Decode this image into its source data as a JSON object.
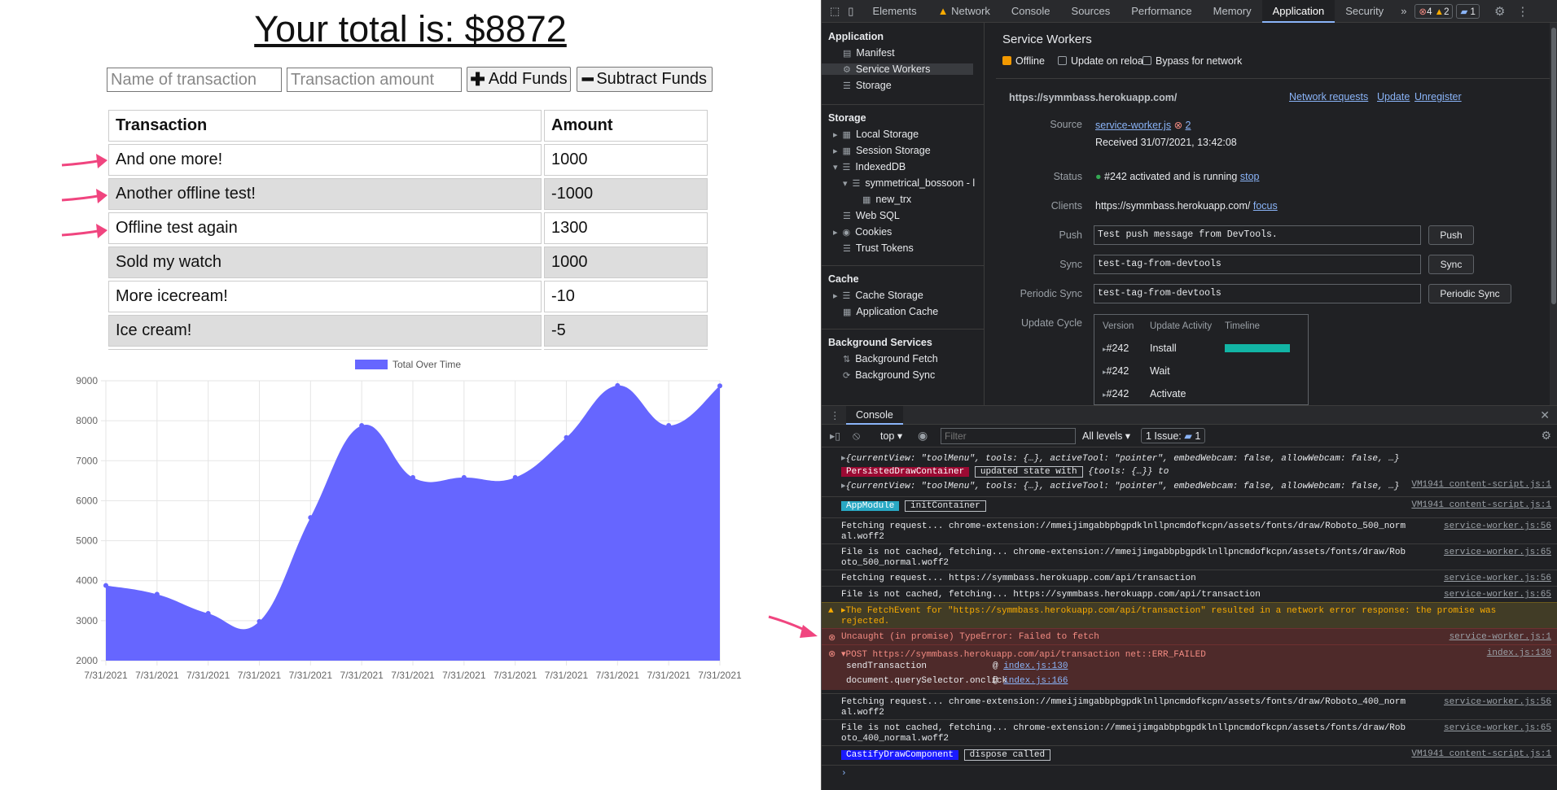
{
  "app": {
    "title": "Your total is: $8872",
    "name_placeholder": "Name of transaction",
    "amount_placeholder": "Transaction amount",
    "add_label": "Add Funds",
    "subtract_label": "Subtract Funds",
    "table_headers": [
      "Transaction",
      "Amount"
    ],
    "rows": [
      {
        "name": "And one more!",
        "amount": "1000"
      },
      {
        "name": "Another offline test!",
        "amount": "-1000"
      },
      {
        "name": "Offline test again",
        "amount": "1300"
      },
      {
        "name": "Sold my watch",
        "amount": "1000"
      },
      {
        "name": "More icecream!",
        "amount": "-10"
      },
      {
        "name": "Ice cream!",
        "amount": "-5"
      }
    ]
  },
  "chart_data": {
    "type": "area",
    "legend": "Total Over Time",
    "series_color": "#6666ff",
    "x": [
      "7/31/2021",
      "7/31/2021",
      "7/31/2021",
      "7/31/2021",
      "7/31/2021",
      "7/31/2021",
      "7/31/2021",
      "7/31/2021",
      "7/31/2021",
      "7/31/2021",
      "7/31/2021",
      "7/31/2021",
      "7/31/2021"
    ],
    "values": [
      3880,
      3660,
      3180,
      2980,
      5580,
      7880,
      6580,
      6580,
      6580,
      7580,
      8880,
      7880,
      8872
    ],
    "ylim": [
      2000,
      9000
    ],
    "yticks": [
      "9000",
      "8000",
      "7000",
      "6000",
      "5000",
      "4000",
      "3000",
      "2000"
    ],
    "grid": true
  },
  "devtools": {
    "tabs": [
      "Elements",
      "Network",
      "Console",
      "Sources",
      "Performance",
      "Memory",
      "Application",
      "Security"
    ],
    "active_tab": "Application",
    "errors": "4",
    "warnings": "2",
    "messages": "1",
    "sidebar": {
      "application_header": "Application",
      "application_items": [
        "Manifest",
        "Service Workers",
        "Storage"
      ],
      "storage_header": "Storage",
      "storage_items": [
        "Local Storage",
        "Session Storage",
        "IndexedDB",
        "symmetrical_bossoon - l",
        "new_trx",
        "Web SQL",
        "Cookies",
        "Trust Tokens"
      ],
      "cache_header": "Cache",
      "cache_items": [
        "Cache Storage",
        "Application Cache"
      ],
      "bg_header": "Background Services",
      "bg_items": [
        "Background Fetch",
        "Background Sync"
      ]
    },
    "sw": {
      "title": "Service Workers",
      "offline": "Offline",
      "update_on_reload": "Update on reload",
      "bypass": "Bypass for network",
      "origin": "https://symmbass.herokuapp.com/",
      "network_requests": "Network requests",
      "update": "Update",
      "unregister": "Unregister",
      "source_label": "Source",
      "source": "service-worker.js",
      "source_errors": "2",
      "received": "Received 31/07/2021, 13:42:08",
      "status_label": "Status",
      "status": "#242 activated and is running",
      "stop": "stop",
      "clients_label": "Clients",
      "clients": "https://symmbass.herokuapp.com/",
      "focus": "focus",
      "push_label": "Push",
      "push_value": "Test push message from DevTools.",
      "push_btn": "Push",
      "sync_label": "Sync",
      "sync_value": "test-tag-from-devtools",
      "sync_btn": "Sync",
      "psync_label": "Periodic Sync",
      "psync_value": "test-tag-from-devtools",
      "psync_btn": "Periodic Sync",
      "cycle_label": "Update Cycle",
      "cycle_headers": [
        "Version",
        "Update Activity",
        "Timeline"
      ],
      "cycle_rows": [
        {
          "v": "#242",
          "a": "Install"
        },
        {
          "v": "#242",
          "a": "Wait"
        },
        {
          "v": "#242",
          "a": "Activate"
        }
      ]
    },
    "console": {
      "drawer_tab": "Console",
      "context": "top",
      "filter_placeholder": "Filter",
      "levels": "All levels",
      "issues": "1 Issue:",
      "issues_count": "1",
      "lines": [
        {
          "text": "{currentView: \"toolMenu\", tools: {…}, activeTool: \"pointer\", embedWebcam: false, allowWebcam: false, …}",
          "src": ""
        },
        {
          "tag": "PersistedDrawContainer",
          "tag2": "updated state with",
          "text": "{tools: {…}} to",
          "src": ""
        },
        {
          "text": "{currentView: \"toolMenu\", tools: {…}, activeTool: \"pointer\", embedWebcam: false, allowWebcam: false, …}",
          "src": "VM1941 content-script.js:1"
        },
        {
          "tag": "AppModule",
          "tag2": "initContainer",
          "src": "VM1941 content-script.js:1"
        },
        {
          "text": "Fetching request... chrome-extension://mmeijimgabbpbgpdklnllpncmdofkcpn/assets/fonts/draw/Roboto_500_norm",
          "text2": "al.woff2",
          "src": "service-worker.js:56"
        },
        {
          "text": "File is not cached, fetching... chrome-extension://mmeijimgabbpbgpdklnllpncmdofkcpn/assets/fonts/draw/Rob",
          "text2": "oto_500_normal.woff2",
          "src": "service-worker.js:65"
        },
        {
          "text": "Fetching request... https://symmbass.herokuapp.com/api/transaction",
          "src": "service-worker.js:56"
        },
        {
          "text": "File is not cached, fetching... https://symmbass.herokuapp.com/api/transaction",
          "src": "service-worker.js:65"
        },
        {
          "text": "The FetchEvent for \"https://symmbass.herokuapp.com/api/transaction\" resulted in a network error response: the promise was",
          "text2": "rejected.",
          "src": ""
        },
        {
          "text": "Uncaught (in promise) TypeError: Failed to fetch",
          "src": "service-worker.js:1"
        },
        {
          "text": "POST https://symmbass.herokuapp.com/api/transaction net::ERR_FAILED",
          "src": "index.js:130"
        },
        {
          "text": "sendTransaction",
          "link": "index.js:130"
        },
        {
          "text": "document.querySelector.onclick",
          "link": "index.js:166"
        },
        {
          "text": "Fetching request... chrome-extension://mmeijimgabbpbgpdklnllpncmdofkcpn/assets/fonts/draw/Roboto_400_norm",
          "text2": "al.woff2",
          "src": "service-worker.js:56"
        },
        {
          "text": "File is not cached, fetching... chrome-extension://mmeijimgabbpbgpdklnllpncmdofkcpn/assets/fonts/draw/Rob",
          "text2": "oto_400_normal.woff2",
          "src": "service-worker.js:65"
        },
        {
          "tag": "CastifyDrawComponent",
          "tag2": "dispose called",
          "src": "VM1941 content-script.js:1"
        }
      ]
    }
  }
}
